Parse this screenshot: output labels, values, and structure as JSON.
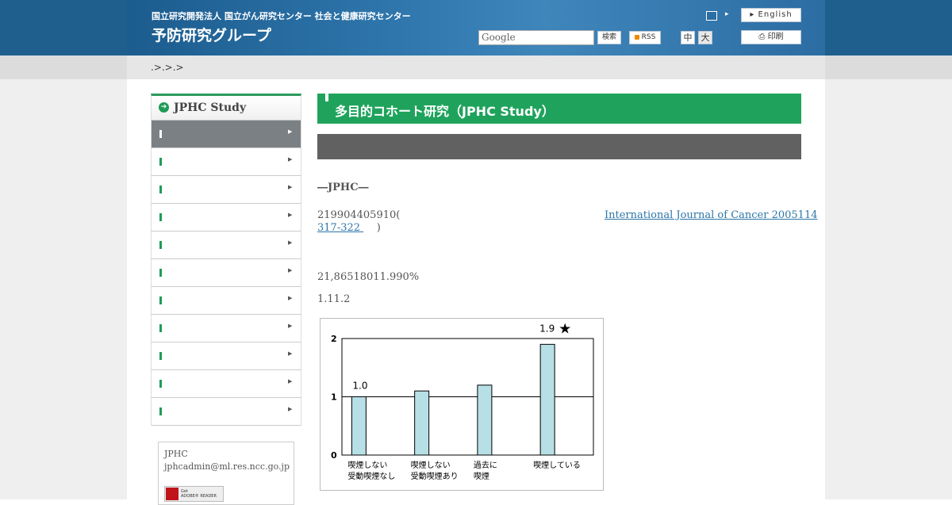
{
  "header": {
    "org": "国立研究開発法人 国立がん研究センター 社会と健康研究センター",
    "site_title": "予防研究グループ",
    "english_label": "English",
    "print_label": "印刷",
    "search_placeholder": "Google",
    "search_button": "検索",
    "rss_label": "RSS",
    "font_mid": "中",
    "font_big": "大"
  },
  "breadcrumb": ".>.>.>",
  "sidebar": {
    "title": "JPHC Study",
    "items": [
      {
        "label": "",
        "active": true
      },
      {
        "label": "",
        "active": false
      },
      {
        "label": "",
        "active": false
      },
      {
        "label": "",
        "active": false
      },
      {
        "label": "",
        "active": false
      },
      {
        "label": "",
        "active": false
      },
      {
        "label": "",
        "active": false
      },
      {
        "label": "",
        "active": false
      },
      {
        "label": "",
        "active": false
      },
      {
        "label": "",
        "active": false
      },
      {
        "label": "",
        "active": false
      }
    ],
    "contact_name": "JPHC",
    "contact_email": "jphcadmin@ml.res.ncc.go.jp",
    "adobe_line1": "Get",
    "adobe_line2": "ADOBE® READER"
  },
  "main": {
    "page_title": "多目的コホート研究（JPHC Study）",
    "subtitle": "―JPHC―",
    "para1_start": "219904405910(",
    "para1_link": "International Journal of Cancer 2005114",
    "para1_link2": "317-322 ",
    "para1_end": ")",
    "para2": " 21,86518011.990%",
    "para3": "1.11.2"
  },
  "chart_data": {
    "type": "bar",
    "categories": [
      [
        "喫煙しない",
        "受動喫煙なし"
      ],
      [
        "喫煙しない",
        "受動喫煙あり"
      ],
      [
        "過去に",
        "喫煙"
      ],
      [
        "喫煙している"
      ]
    ],
    "values": [
      1.0,
      1.1,
      1.2,
      1.9
    ],
    "data_labels": [
      "1.0",
      "",
      "",
      "1.9"
    ],
    "star_on": 3,
    "ylim": [
      0,
      2
    ],
    "yticks": [
      "0",
      "1",
      "2"
    ],
    "reference_line": 1,
    "bar_color": "#b7dfe6",
    "grid": false
  }
}
